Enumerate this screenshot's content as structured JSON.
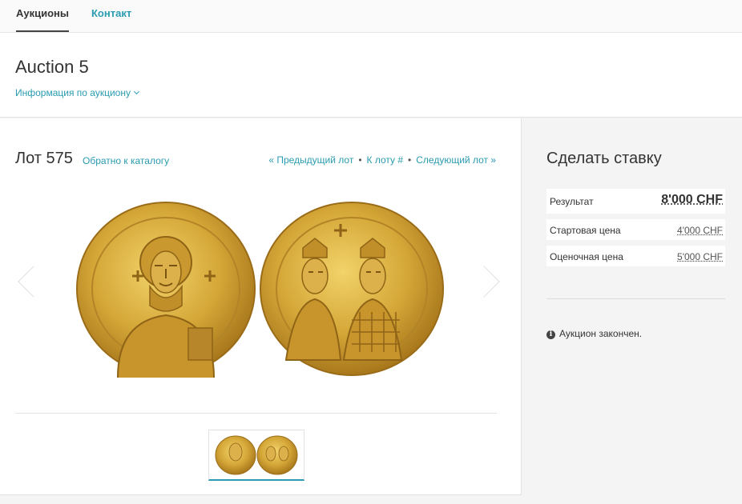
{
  "nav": {
    "tabs": [
      {
        "label": "Аукционы",
        "active": true
      },
      {
        "label": "Контакт",
        "active": false
      }
    ]
  },
  "header": {
    "title": "Auction 5",
    "info_link": "Информация по аукциону"
  },
  "lot": {
    "title": "Лот 575",
    "back_link": "Обратно к каталогу",
    "prev_link": "« Предыдущий лот",
    "goto_link": "К лоту #",
    "next_link": "Следующий лот »",
    "separator": "•"
  },
  "bid": {
    "title": "Сделать ставку",
    "result_label": "Результат",
    "result_value": "8'000 CHF",
    "start_label": "Стартовая цена",
    "start_value": "4'000 CHF",
    "estimate_label": "Оценочная цена",
    "estimate_value": "5'000 CHF",
    "status": "Аукцион закончен."
  },
  "icons": {
    "prev": "chevron-left-icon",
    "next": "chevron-right-icon",
    "dropdown": "chevron-down-icon",
    "status": "info-circle-icon"
  },
  "colors": {
    "accent": "#2a9bb0",
    "gold": "#d4a637"
  }
}
